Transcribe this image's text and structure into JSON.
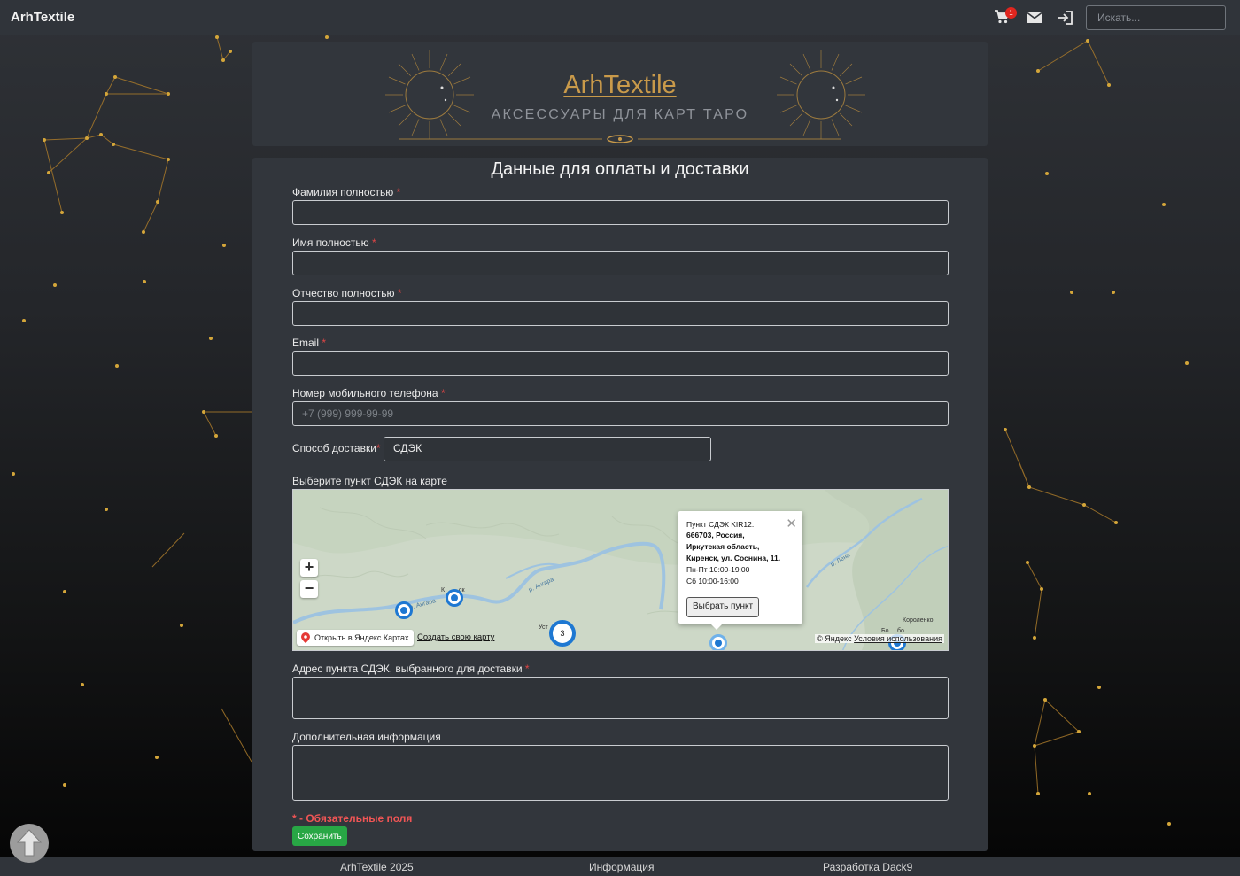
{
  "navbar": {
    "brand": "ArhTextile",
    "cart_count": "1",
    "search_placeholder": "Искать..."
  },
  "banner": {
    "title": "ArhTextile",
    "subtitle": "АКСЕССУАРЫ ДЛЯ КАРТ ТАРО"
  },
  "form": {
    "title": "Данные для оплаты и доставки",
    "fields": {
      "last_name": {
        "label": "Фамилия полностью",
        "value": ""
      },
      "first_name": {
        "label": "Имя полностью",
        "value": ""
      },
      "patronymic": {
        "label": "Отчество полностью",
        "value": ""
      },
      "email": {
        "label": "Email",
        "value": ""
      },
      "phone": {
        "label": "Номер мобильного телефона",
        "placeholder": "+7 (999) 999-99-99"
      },
      "delivery": {
        "label": "Способ доставки",
        "value": "СДЭК"
      },
      "map": {
        "label": "Выберите пункт СДЭК на карте"
      },
      "address": {
        "label": "Адрес пункта СДЭК, выбранного для доставки",
        "value": ""
      },
      "extra": {
        "label": "Дополнительная информация",
        "value": ""
      }
    },
    "required_mark": "*",
    "required_note": "* - Обязательные поля",
    "save_label": "Сохранить"
  },
  "map": {
    "cluster_count": "3",
    "river_label_1": "р. Ангара",
    "river_label_2": "р. Ангара",
    "river_label_3": "р. Лена",
    "town_korenko": "Короленко",
    "town_partial_1": "К",
    "town_partial_2": "ск",
    "town_partial_3": "Уст",
    "town_partial_4": "Бо",
    "town_partial_5": "бо",
    "open_link": "Открыть в Яндекс.Картах",
    "create_link": "Создать свою карту",
    "copyright": "© Яндекс",
    "terms": "Условия использования",
    "balloon": {
      "line1": "Пункт СДЭК KIR12.",
      "line2": "666703, Россия,",
      "line3": "Иркутская область,",
      "line4": "Киренск, ул. Соснина, 11.",
      "line5": "Пн-Пт 10:00-19:00",
      "line6": "Сб 10:00-16:00",
      "button": "Выбрать пункт"
    }
  },
  "footer": {
    "left": "ArhTextile 2025",
    "center": "Информация",
    "right": "Разработка Dack9"
  },
  "colors": {
    "accent_gold": "#c99a4a",
    "success": "#28a745",
    "required": "#e04545",
    "map_marker": "#1e78d2"
  }
}
